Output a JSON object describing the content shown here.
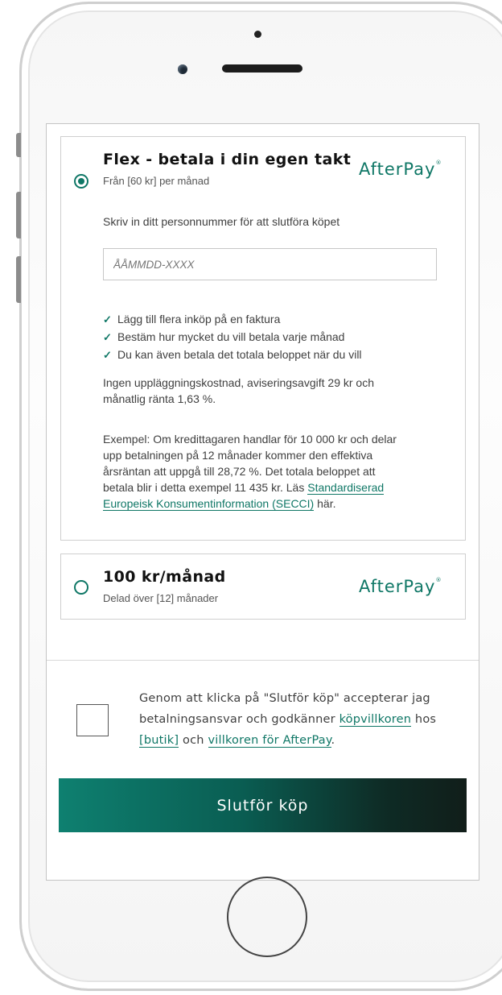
{
  "options": [
    {
      "title": "Flex - betala i din egen takt",
      "subtitle": "Från [60 kr] per månad",
      "selected": true,
      "logo": "AfterPay",
      "prompt": "Skriv in ditt personnummer för att slutföra köpet",
      "input_placeholder": "ÅÅMMDD-XXXX",
      "input_value": "",
      "benefits": [
        "Lägg till flera inköp på en faktura",
        "Bestäm hur mycket du vill betala varje månad",
        "Du kan även betala det totala beloppet när du vill"
      ],
      "fee_line1": "Ingen uppläggningskostnad, aviseringsavgift 29 kr och",
      "fee_line2": "månatlig ränta 1,63 %.",
      "example_line1": "Exempel: Om kredittagaren handlar för 10 000 kr och delar",
      "example_line2": "upp betalningen på 12 månader kommer den effektiva",
      "example_line3": "årsräntan att uppgå till 28,72 %. Det totala beloppet att",
      "example_line4": "betala blir i detta exempel 11 435 kr. Läs",
      "secci_link_part1": "Standardiserad",
      "secci_link_part2": "Europeisk Konsumentinformation (SECCI)",
      "example_suffix": " här."
    },
    {
      "title": "100 kr/månad",
      "subtitle": "Delad över [12] månader",
      "selected": false,
      "logo": "AfterPay"
    }
  ],
  "consent": {
    "checked": false,
    "line1": "Genom att klicka på \"Slutför köp\" accepterar jag",
    "line2_prefix": "betalningsansvar och godkänner ",
    "terms_link": "köpvillkoren",
    "line2_suffix": " hos",
    "shop_link": "[butik]",
    "and_text": " och ",
    "afterpay_terms_link": "villkoren för AfterPay",
    "period": "."
  },
  "submit_label": "Slutför köp",
  "colors": {
    "accent": "#0f7766",
    "button_gradient_start": "#0e8070",
    "button_gradient_end": "#111e1a"
  },
  "icons": {
    "check": "checkmark-icon",
    "logo": "afterpay-logo"
  }
}
